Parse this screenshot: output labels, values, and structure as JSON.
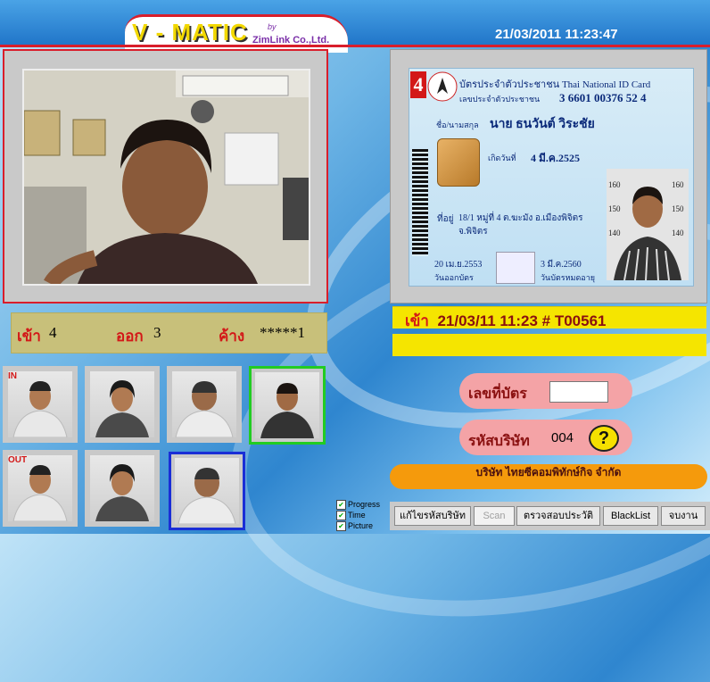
{
  "app": {
    "logo": "V - MATIC",
    "logo_by": "by",
    "company": "ZimLink Co.,Ltd.",
    "datetime": "21/03/2011 11:23:47"
  },
  "counts": {
    "in_label": "เข้า",
    "in_value": "4",
    "out_label": "ออก",
    "out_value": "3",
    "pending_label": "ค้าง",
    "pending_value": "*****1"
  },
  "id_card": {
    "number_badge": "4",
    "title": "บัตรประจำตัวประชาชน Thai National ID Card",
    "id_label": "เลขประจำตัวประชาชน",
    "id_number": "3 6601 00376 52 4",
    "name_label": "ชื่อ/นามสกุล",
    "name": "นาย ธนวันต์ วิระชัย",
    "dob_label": "เกิดวันที่",
    "dob": "4 มี.ค.2525",
    "address_label": "ที่อยู่",
    "address_line1": "18/1 หมู่ที่ 4 ต.ฆะมัง อ.เมืองพิจิตร",
    "address_line2": "จ.พิจิตร",
    "issue_date": "20 เม.ย.2553",
    "issue_label": "วันออกบัตร",
    "expiry_date": "3 มี.ค.2560",
    "expiry_label": "วันบัตรหมดอายุ",
    "height_marks": [
      "160",
      "150",
      "140"
    ]
  },
  "entry": {
    "label": "เข้า",
    "text": "21/03/11  11:23  # T00561",
    "message": ""
  },
  "thumbnails": {
    "in_label": "IN",
    "out_label": "OUT"
  },
  "form": {
    "card_no_label": "เลขที่บัตร",
    "card_no_value": "",
    "company_code_label": "รหัสบริษัท",
    "company_code_value": "004",
    "help_label": "?",
    "company_name": "บริษัท ไทยซีคอมพิทักษ์กิจ จำกัด"
  },
  "options": {
    "progress": "Progress",
    "time": "Time",
    "picture": "Picture"
  },
  "buttons": {
    "edit_company": "แก้ไขรหัสบริษัท",
    "scan": "Scan",
    "check_history": "ตรวจสอบประวัติ",
    "blacklist": "BlackList",
    "finish": "จบงาน"
  },
  "colors": {
    "accent_red": "#d91e2b",
    "banner_yellow": "#f5e500",
    "company_orange": "#f59a0c",
    "pill_pink": "#f4a3a6",
    "selected_green": "#22cc22",
    "selected_blue": "#1a2ed6"
  }
}
